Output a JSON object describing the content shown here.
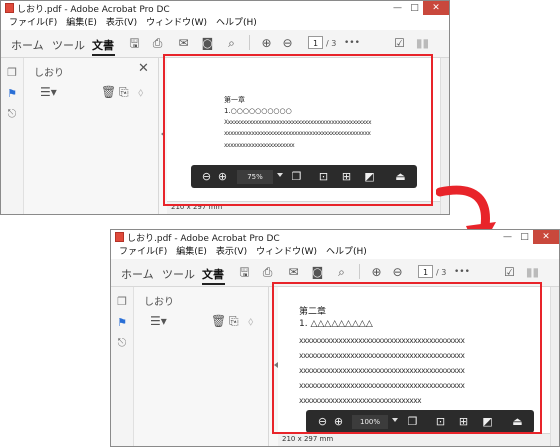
{
  "window": {
    "title": "しおり.pdf - Adobe Acrobat Pro DC",
    "controls": {
      "minimize": "—",
      "maximize": "□",
      "close": "✕"
    }
  },
  "menu": [
    "ファイル(F)",
    "編集(E)",
    "表示(V)",
    "ウィンドウ(W)",
    "ヘルプ(H)"
  ],
  "toolbar": {
    "tabs": [
      "ホーム",
      "ツール",
      "文書"
    ],
    "active_tab": "文書",
    "icons": [
      "save-icon",
      "print-icon",
      "mail-icon",
      "scan-icon",
      "search-icon",
      "page-up-icon",
      "page-down-icon",
      "more-icon",
      "sign-icon",
      "account-icon"
    ],
    "page_number": "1",
    "page_total": "/ 3",
    "more_label": "•••"
  },
  "sidebar": {
    "rail_icons": [
      "pages-icon",
      "bookmark-icon",
      "attachment-icon"
    ],
    "bookmark_panel": {
      "title": "しおり",
      "close": "✕",
      "icons": [
        "options-icon",
        "delete-icon",
        "new-bookmark-icon",
        "expand-icon"
      ]
    }
  },
  "status": {
    "page_size": "210 x 297 mm"
  },
  "floating_toolbar": {
    "icons": [
      "zoom-out-icon",
      "zoom-in-icon",
      "page-thumbnail-icon",
      "fit-page-icon",
      "fit-width-icon",
      "full-screen-icon",
      "reading-mode-icon"
    ]
  },
  "before": {
    "zoom": "75%",
    "doc": {
      "heading": "第一章",
      "item": "1.○○○○○○○○○○",
      "lines": [
        "Xxxxxxxxxxxxxxxxxxxxxxxxxxxxxxxxxxxxxxxxxxxxxxxx",
        "xxxxxxxxxxxxxxxxxxxxxxxxxxxxxxxxxxxxxxxxxxxxxxxx",
        "xxxxxxxxxxxxxxxxxxxxxxx"
      ]
    }
  },
  "after": {
    "zoom": "100%",
    "doc": {
      "heading": "第二章",
      "item": "1. △△△△△△△△△",
      "lines": [
        "xxxxxxxxxxxxxxxxxxxxxxxxxxxxxxxxxxxxxxxxxx",
        "xxxxxxxxxxxxxxxxxxxxxxxxxxxxxxxxxxxxxxxxxx",
        "xxxxxxxxxxxxxxxxxxxxxxxxxxxxxxxxxxxxxxxxxx",
        "xxxxxxxxxxxxxxxxxxxxxxxxxxxxxxxxxxxxxxxxxx",
        "xxxxxxxxxxxxxxxxxxxxxxxxxxxxxxx"
      ]
    }
  },
  "colors": {
    "highlight": "#e8242a",
    "arrow": "#e8242a",
    "accent": "#2a6fd6",
    "floatbar": "#2b2b2b"
  }
}
